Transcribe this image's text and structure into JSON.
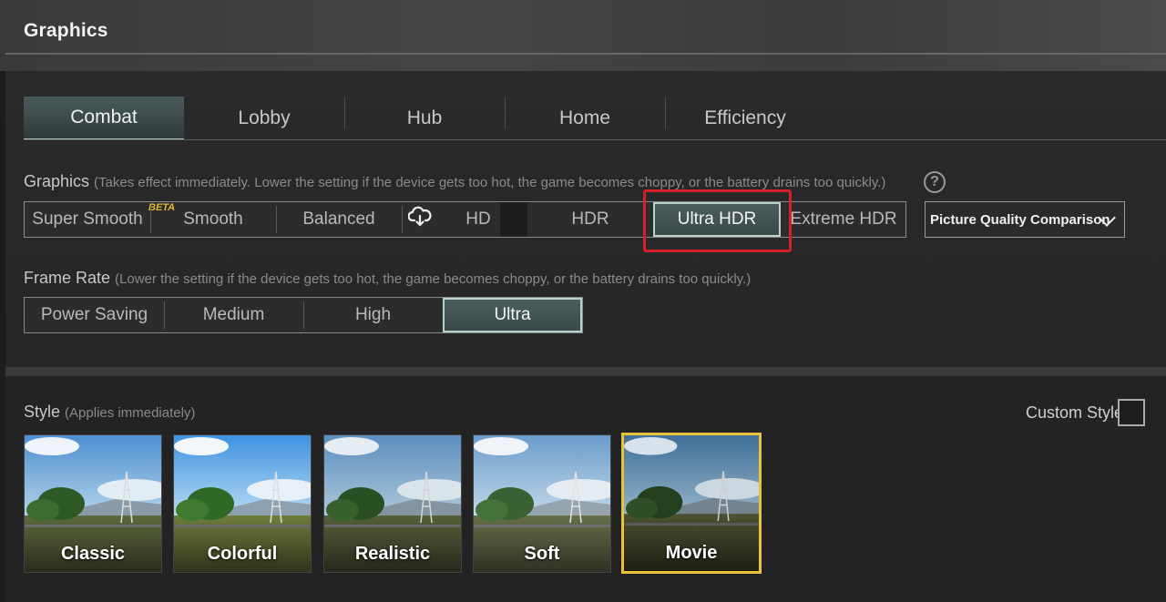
{
  "header": {
    "title": "Graphics"
  },
  "tabs": [
    {
      "label": "Combat",
      "active": true
    },
    {
      "label": "Lobby",
      "active": false
    },
    {
      "label": "Hub",
      "active": false
    },
    {
      "label": "Home",
      "active": false
    },
    {
      "label": "Efficiency",
      "active": false
    }
  ],
  "graphics": {
    "label": "Graphics",
    "hint": "(Takes effect immediately. Lower the setting if the device gets too hot, the game becomes choppy, or the battery drains too quickly.)",
    "options": [
      {
        "label": "Super Smooth",
        "badge": "BETA"
      },
      {
        "label": "Smooth"
      },
      {
        "label": "Balanced"
      },
      {
        "label": "HD",
        "icon": "cloud-download-icon"
      },
      {
        "label": "HDR"
      },
      {
        "label": "Ultra HDR",
        "selected": true
      },
      {
        "label": "Extreme HDR"
      }
    ],
    "compare_label": "Picture Quality Comparison"
  },
  "frame_rate": {
    "label": "Frame Rate",
    "hint": "(Lower the setting if the device gets too hot, the game becomes choppy, or the battery drains too quickly.)",
    "options": [
      {
        "label": "Power Saving"
      },
      {
        "label": "Medium"
      },
      {
        "label": "High"
      },
      {
        "label": "Ultra",
        "selected": true
      }
    ]
  },
  "style": {
    "label": "Style",
    "hint": "(Applies immediately)",
    "custom_label": "Custom Style",
    "custom_checked": false,
    "options": [
      {
        "label": "Classic"
      },
      {
        "label": "Colorful"
      },
      {
        "label": "Realistic"
      },
      {
        "label": "Soft"
      },
      {
        "label": "Movie",
        "selected": true
      }
    ]
  },
  "colors": {
    "selection_border": "#b8d2cc",
    "highlight_red": "#d3202a",
    "style_selected": "#e8c23a"
  }
}
